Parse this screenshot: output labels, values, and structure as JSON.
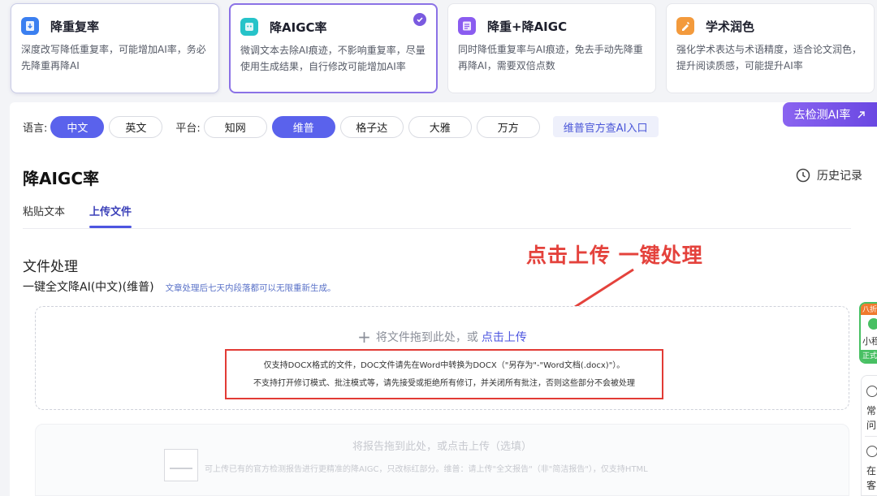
{
  "modes": [
    {
      "title": "降重复率",
      "desc": "深度改写降低重复率，可能增加AI率，务必先降重再降AI",
      "icon": "doc-down-icon",
      "color": "#3b7ff0"
    },
    {
      "title": "降AIGC率",
      "desc": "微调文本去除AI痕迹，不影响重复率，尽量使用生成结果，自行修改可能增加AI率",
      "icon": "robot-doc-icon",
      "color": "#26c3c9"
    },
    {
      "title": "降重+降AIGC",
      "desc": "同时降低重复率与AI痕迹，免去手动先降重再降AI，需要双倍点数",
      "icon": "doc-combo-icon",
      "color": "#8a5cf0"
    },
    {
      "title": "学术润色",
      "desc": "强化学术表达与术语精度，适合论文润色，提升阅读质感，可能提升AI率",
      "icon": "brush-icon",
      "color": "#f39a3c"
    }
  ],
  "detect_button": "去检测AI率",
  "language": {
    "label": "语言:",
    "options": [
      "中文",
      "英文"
    ],
    "selected": "中文"
  },
  "platform": {
    "label": "平台:",
    "options": [
      "知网",
      "维普",
      "格子达",
      "大雅",
      "万方"
    ],
    "selected": "维普"
  },
  "official_link": "维普官方查AI入口",
  "page_title": "降AIGC率",
  "history": "历史记录",
  "tabs": [
    {
      "label": "粘贴文本",
      "active": false
    },
    {
      "label": "上传文件",
      "active": true
    }
  ],
  "file_section": {
    "title": "文件处理",
    "subtitle": "一键全文降AI(中文)(维普)",
    "note": "文章处理后七天内段落都可以无限重新生成。"
  },
  "annotation": "点击上传 一键处理",
  "dropzone": {
    "text": "将文件拖到此处，或",
    "click_text": "点击上传",
    "warn1": "仅支持DOCX格式的文件，DOC文件请先在Word中转换为DOCX（\"另存为\"-\"Word文档(.docx)\"）。",
    "warn2": "不支持打开修订模式、批注模式等，请先接受或拒绝所有修订，并关闭所有批注，否则这些部分不会被处理"
  },
  "report_zone": {
    "title": "将报告拖到此处，或点击上传（选填）",
    "note": "可上传已有的官方检测报告进行更精准的降AIGC，只改标红部分。维普：请上传\"全文报告\"（非\"简洁报告\"），仅支持HTML"
  },
  "side_widgets": {
    "promo_tag": "八折",
    "promo_text": "小程",
    "promo_badge": "正式",
    "faq_label": "常",
    "faq_label2": "问",
    "service_label": "在",
    "service_label2": "客"
  }
}
